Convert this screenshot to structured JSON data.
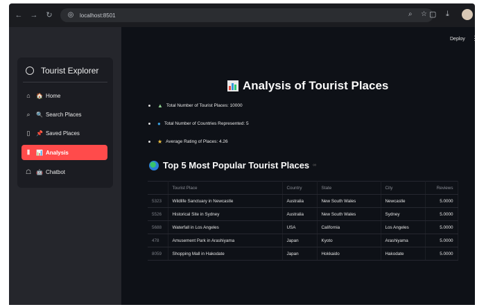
{
  "browser": {
    "url": "localhost:8501",
    "nav_icons": [
      "back-icon",
      "forward-icon",
      "reload-icon"
    ]
  },
  "header": {
    "deploy_label": "Deploy",
    "menu_icon": "kebab-menu-icon"
  },
  "sidebar": {
    "title": "Tourist Explorer",
    "items": [
      {
        "label": "Home",
        "icon": "home-icon",
        "emoji": "🏠",
        "active": false
      },
      {
        "label": "Search Places",
        "icon": "search-icon",
        "emoji": "🔍",
        "active": false
      },
      {
        "label": "Saved Places",
        "icon": "bookmark-icon",
        "emoji": "📌",
        "active": false
      },
      {
        "label": "Analysis",
        "icon": "chart-icon",
        "emoji": "📊",
        "active": true
      },
      {
        "label": "Chatbot",
        "icon": "robot-icon",
        "emoji": "🤖",
        "active": false
      }
    ]
  },
  "main": {
    "title": "Analysis of Tourist Places",
    "stats": [
      {
        "icon": "mountain-icon",
        "glyph": "▲",
        "color": "#8fd18f",
        "text": "Total Number of Tourist Places: 10000"
      },
      {
        "icon": "globe-icon",
        "glyph": "●",
        "color": "#39a0e0",
        "text": "Total Number of Countries Represented: 5"
      },
      {
        "icon": "star-icon",
        "glyph": "★",
        "color": "#f4c542",
        "text": "Average Rating of Places: 4.26"
      }
    ],
    "table_title": "Top 5 Most Popular Tourist Places",
    "table_headers": [
      "",
      "Tourist Place",
      "Country",
      "State",
      "City",
      "Reviews"
    ],
    "table_rows": [
      {
        "idx": "5323",
        "place": "Wildlife Sanctuary in Newcastle",
        "country": "Australia",
        "state": "New South Wales",
        "city": "Newcastle",
        "reviews": "5.0000"
      },
      {
        "idx": "5526",
        "place": "Historical Site in Sydney",
        "country": "Australia",
        "state": "New South Wales",
        "city": "Sydney",
        "reviews": "5.0000"
      },
      {
        "idx": "5688",
        "place": "Waterfall in Los Angeles",
        "country": "USA",
        "state": "California",
        "city": "Los Angeles",
        "reviews": "5.0000"
      },
      {
        "idx": "478",
        "place": "Amusement Park in Arashiyama",
        "country": "Japan",
        "state": "Kyoto",
        "city": "Arashiyama",
        "reviews": "5.0000"
      },
      {
        "idx": "8059",
        "place": "Shopping Mall in Hakodate",
        "country": "Japan",
        "state": "Hokkaido",
        "city": "Hakodate",
        "reviews": "5.0000"
      }
    ]
  }
}
